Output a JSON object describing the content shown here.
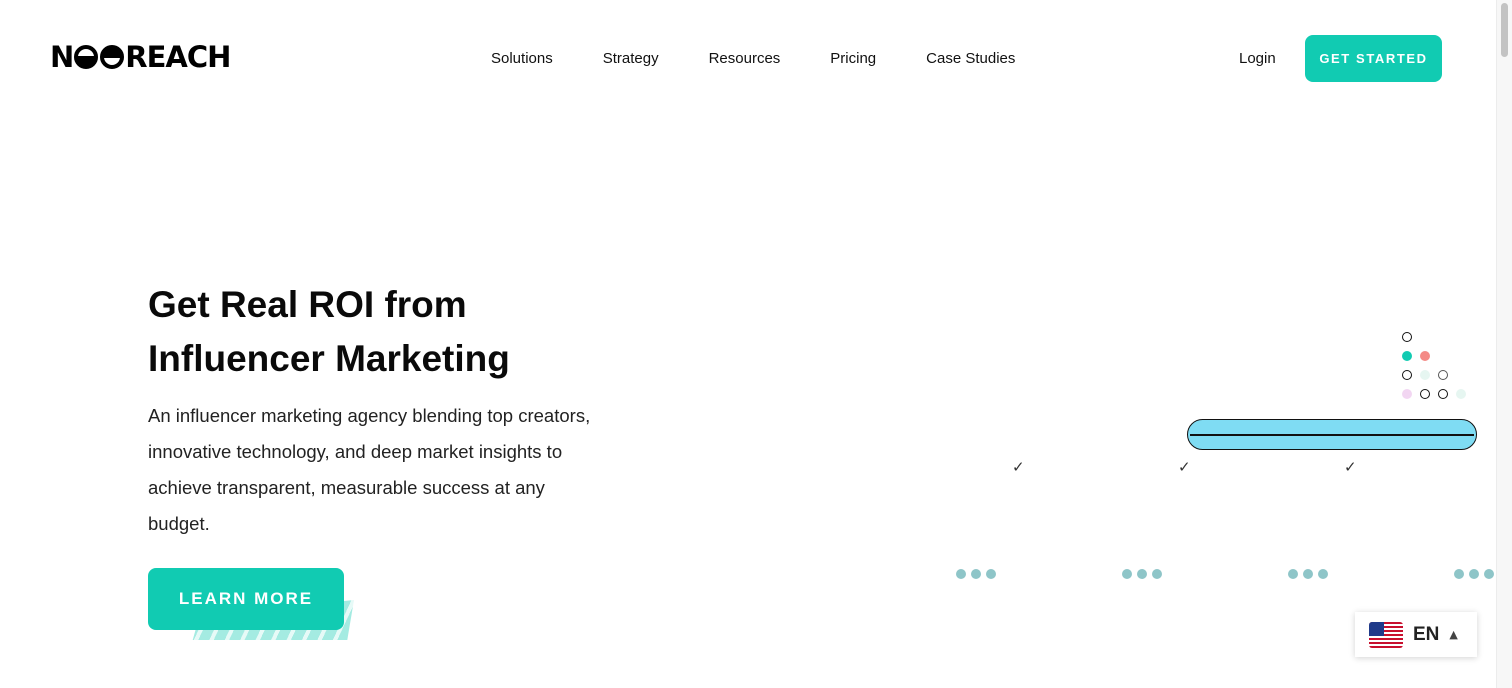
{
  "header": {
    "logo_text": "NEOREACH",
    "nav": [
      "Solutions",
      "Strategy",
      "Resources",
      "Pricing",
      "Case Studies"
    ],
    "login_label": "Login",
    "cta_label": "GET STARTED"
  },
  "hero": {
    "title_line1": "Get Real ROI from",
    "title_line2": "Influencer Marketing",
    "description": "An influencer marketing agency blending top creators, innovative technology, and deep market insights to achieve transparent, measurable success at any budget.",
    "button_label": "LEARN MORE"
  },
  "decor": {
    "check_glyph": "✓",
    "pill_color": "#7fdcf3",
    "dot_colors": [
      "#11cbb2",
      "#f48a86",
      "#e6f6f1",
      "#f2d6f2",
      "#8ec5c8"
    ]
  },
  "language": {
    "code": "EN",
    "flag_icon": "us-flag-icon",
    "chevron": "▲"
  },
  "colors": {
    "accent": "#11cbb2",
    "text": "#111111"
  }
}
